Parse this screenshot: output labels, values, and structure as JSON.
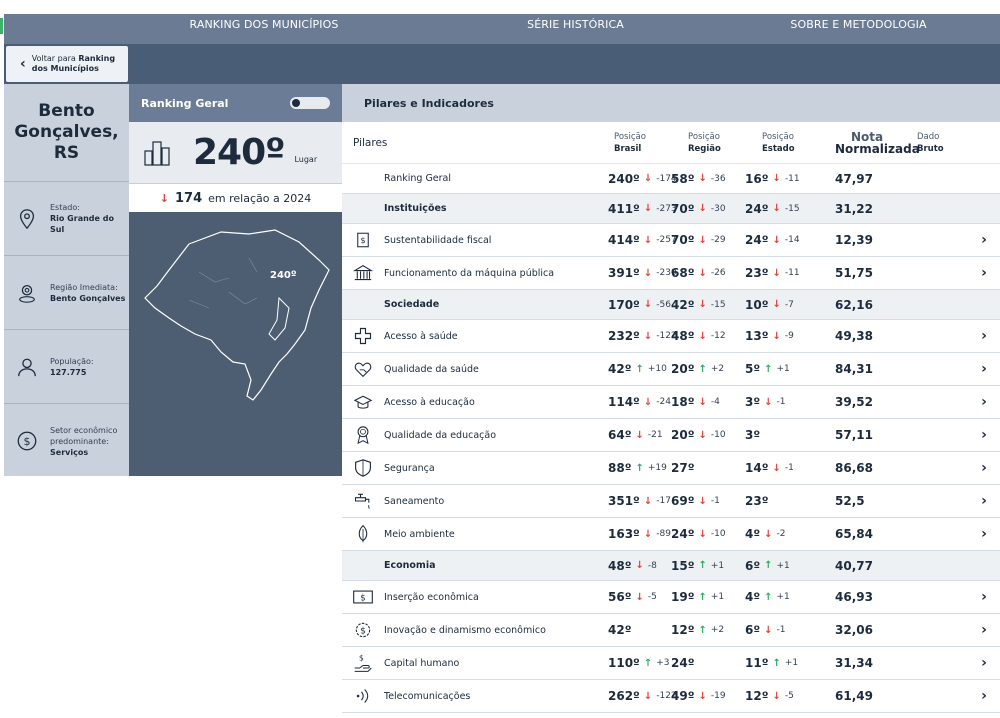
{
  "nav": {
    "tabs": [
      "RANKING DOS MUNICÍPIOS",
      "SÉRIE HISTÓRICA",
      "SOBRE E METODOLOGIA"
    ]
  },
  "back": {
    "prefix": "Voltar para ",
    "bold1": "Ranking",
    "bold2": "dos Municípios"
  },
  "municipio": {
    "name_line1": "Bento",
    "name_line2": "Gonçalves,",
    "name_line3": "RS",
    "estado_label": "Estado:",
    "estado_value": "Rio Grande do Sul",
    "regiao_label": "Região Imediata:",
    "regiao_value": "Bento Gonçalves",
    "populacao_label": "População:",
    "populacao_value": "127.775",
    "setor_label": "Setor econômico predominante:",
    "setor_value": "Serviços"
  },
  "ranking_geral": {
    "title": "Ranking Geral",
    "position": "240º",
    "position_suffix": "Lugar",
    "delta": "174",
    "delta_text": "em relação a 2024",
    "map_label": "240º"
  },
  "table": {
    "title": "Pilares e Indicadores",
    "col_pilares": "Pilares",
    "col_brasil_1": "Posição",
    "col_brasil_2": "Brasil",
    "col_regiao_1": "Posição",
    "col_regiao_2": "Região",
    "col_estado_1": "Posição",
    "col_estado_2": "Estado",
    "col_nota_1": "Nota",
    "col_nota_2": "Normalizada",
    "col_dado_1": "Dado",
    "col_dado_2": "Bruto",
    "rows": [
      {
        "name": "Ranking Geral",
        "icon": "none",
        "group": false,
        "plain": true,
        "b": "240º",
        "bd": "down",
        "bv": "-174",
        "r": "58º",
        "rd": "down",
        "rv": "-36",
        "e": "16º",
        "ed": "down",
        "ev": "-11",
        "nota": "47,97",
        "arrow": false
      },
      {
        "name": "Instituições",
        "icon": "none",
        "group": true,
        "b": "411º",
        "bd": "down",
        "bv": "-273",
        "r": "70º",
        "rd": "down",
        "rv": "-30",
        "e": "24º",
        "ed": "down",
        "ev": "-15",
        "nota": "31,22",
        "arrow": false
      },
      {
        "name": "Sustentabilidade fiscal",
        "icon": "document-dollar-icon",
        "group": false,
        "b": "414º",
        "bd": "down",
        "bv": "-257",
        "r": "70º",
        "rd": "down",
        "rv": "-29",
        "e": "24º",
        "ed": "down",
        "ev": "-14",
        "nota": "12,39",
        "arrow": true
      },
      {
        "name": "Funcionamento da máquina pública",
        "icon": "government-building-icon",
        "group": false,
        "b": "391º",
        "bd": "down",
        "bv": "-230",
        "r": "68º",
        "rd": "down",
        "rv": "-26",
        "e": "23º",
        "ed": "down",
        "ev": "-11",
        "nota": "51,75",
        "arrow": true
      },
      {
        "name": "Sociedade",
        "icon": "none",
        "group": true,
        "b": "170º",
        "bd": "down",
        "bv": "-56",
        "r": "42º",
        "rd": "down",
        "rv": "-15",
        "e": "10º",
        "ed": "down",
        "ev": "-7",
        "nota": "62,16",
        "arrow": false
      },
      {
        "name": "Acesso à saúde",
        "icon": "health-cross-icon",
        "group": false,
        "b": "232º",
        "bd": "down",
        "bv": "-122",
        "r": "48º",
        "rd": "down",
        "rv": "-12",
        "e": "13º",
        "ed": "down",
        "ev": "-9",
        "nota": "49,38",
        "arrow": true
      },
      {
        "name": "Qualidade da saúde",
        "icon": "heart-hand-icon",
        "group": false,
        "b": "42º",
        "bd": "up",
        "bv": "+10",
        "r": "20º",
        "rd": "up",
        "rv": "+2",
        "e": "5º",
        "ed": "up",
        "ev": "+1",
        "nota": "84,31",
        "arrow": true
      },
      {
        "name": "Acesso à educação",
        "icon": "graduation-cap-icon",
        "group": false,
        "b": "114º",
        "bd": "down",
        "bv": "-24",
        "r": "18º",
        "rd": "down",
        "rv": "-4",
        "e": "3º",
        "ed": "down",
        "ev": "-1",
        "nota": "39,52",
        "arrow": true
      },
      {
        "name": "Qualidade da educação",
        "icon": "award-medal-icon",
        "group": false,
        "b": "64º",
        "bd": "down",
        "bv": "-21",
        "r": "20º",
        "rd": "down",
        "rv": "-10",
        "e": "3º",
        "ed": "none",
        "ev": "",
        "nota": "57,11",
        "arrow": true
      },
      {
        "name": "Segurança",
        "icon": "shield-icon",
        "group": false,
        "b": "88º",
        "bd": "up",
        "bv": "+19",
        "r": "27º",
        "rd": "none",
        "rv": "",
        "e": "14º",
        "ed": "down",
        "ev": "-1",
        "nota": "86,68",
        "arrow": true
      },
      {
        "name": "Saneamento",
        "icon": "water-tap-icon",
        "group": false,
        "b": "351º",
        "bd": "down",
        "bv": "-17",
        "r": "69º",
        "rd": "down",
        "rv": "-1",
        "e": "23º",
        "ed": "none",
        "ev": "",
        "nota": "52,5",
        "arrow": true
      },
      {
        "name": "Meio ambiente",
        "icon": "leaf-icon",
        "group": false,
        "b": "163º",
        "bd": "down",
        "bv": "-89",
        "r": "24º",
        "rd": "down",
        "rv": "-10",
        "e": "4º",
        "ed": "down",
        "ev": "-2",
        "nota": "65,84",
        "arrow": true
      },
      {
        "name": "Economia",
        "icon": "none",
        "group": true,
        "b": "48º",
        "bd": "down",
        "bv": "-8",
        "r": "15º",
        "rd": "up",
        "rv": "+1",
        "e": "6º",
        "ed": "up",
        "ev": "+1",
        "nota": "40,77",
        "arrow": false
      },
      {
        "name": "Inserção econômica",
        "icon": "banknote-icon",
        "group": false,
        "b": "56º",
        "bd": "down",
        "bv": "-5",
        "r": "19º",
        "rd": "up",
        "rv": "+1",
        "e": "4º",
        "ed": "up",
        "ev": "+1",
        "nota": "46,93",
        "arrow": true
      },
      {
        "name": "Inovação e dinamismo econômico",
        "icon": "innovation-coin-icon",
        "group": false,
        "b": "42º",
        "bd": "none",
        "bv": "",
        "r": "12º",
        "rd": "up",
        "rv": "+2",
        "e": "6º",
        "ed": "down",
        "ev": "-1",
        "nota": "32,06",
        "arrow": true
      },
      {
        "name": "Capital humano",
        "icon": "hand-money-icon",
        "group": false,
        "b": "110º",
        "bd": "up",
        "bv": "+3",
        "r": "24º",
        "rd": "none",
        "rv": "",
        "e": "11º",
        "ed": "up",
        "ev": "+1",
        "nota": "31,34",
        "arrow": true
      },
      {
        "name": "Telecomunicações",
        "icon": "signal-waves-icon",
        "group": false,
        "b": "262º",
        "bd": "down",
        "bv": "-122",
        "r": "49º",
        "rd": "down",
        "rv": "-19",
        "e": "12º",
        "ed": "down",
        "ev": "-5",
        "nota": "61,49",
        "arrow": true
      }
    ]
  }
}
